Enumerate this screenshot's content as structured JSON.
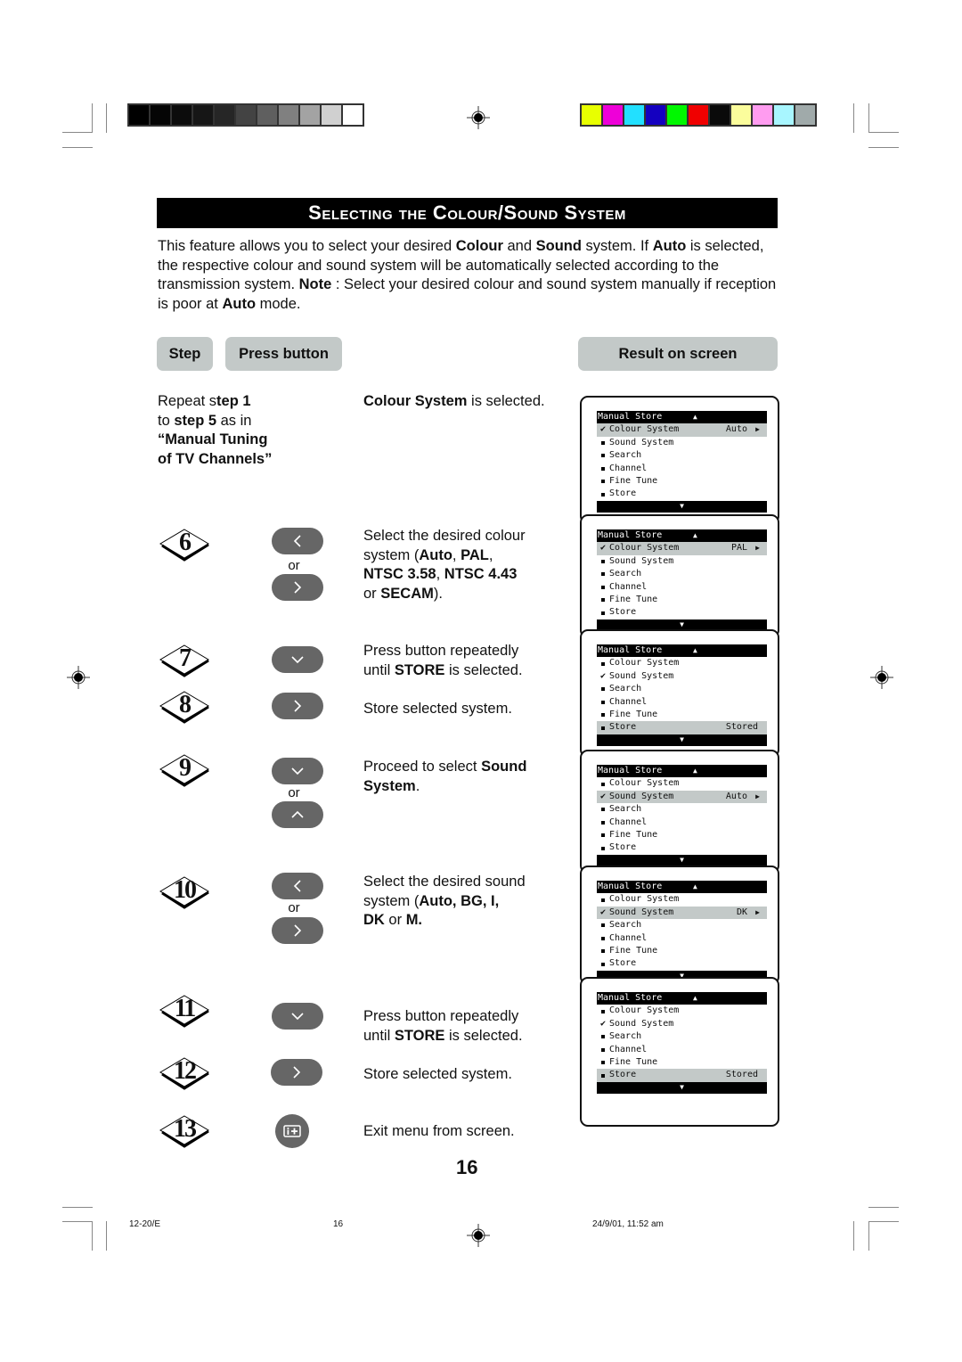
{
  "print_marks": {
    "grayscale_swatches": [
      "#000000",
      "#050505",
      "#0c0c0c",
      "#161616",
      "#262626",
      "#434343",
      "#5f5f5f",
      "#808080",
      "#a3a3a3",
      "#d0d0d0",
      "#ffffff"
    ],
    "color_swatches": [
      "#e8ff00",
      "#ee00d8",
      "#22e0ff",
      "#1400c0",
      "#00f800",
      "#f00000",
      "#0a0a0a",
      "#fbfd9c",
      "#ff9cf0",
      "#a8f6ff",
      "#a0aaaa"
    ]
  },
  "title": "Selecting the  Colour/Sound System",
  "intro": {
    "p1": "This feature allows you to select your desired ",
    "b1": "Colour",
    "p2": " and ",
    "b2": "Sound",
    "p3": " system. If ",
    "b3": "Auto",
    "p4": " is selected, the respective colour and sound system will be automatically selected according to the transmission system. ",
    "b4": "Note",
    "p5": " : Select your desired colour and sound system manually if reception is poor at ",
    "b5": "Auto",
    "p6": " mode."
  },
  "headers": {
    "step": "Step",
    "press_button": "Press button",
    "result": "Result on screen"
  },
  "pre": {
    "line1a": "Repeat s",
    "line1b": "tep 1",
    "line2a": "to ",
    "line2b": "step 5",
    "line2c": " as in",
    "line3": "“Manual Tuning",
    "line4": "of TV Channels”",
    "result_b": "Colour System",
    "result_t": " is selected."
  },
  "steps": [
    {
      "num": "6",
      "buttons": [
        "left",
        "right"
      ],
      "or": "or",
      "t1": "Select the desired colour",
      "t2a": "system  (",
      "t2b": "Auto",
      "t2c": ", ",
      "t2d": "PAL",
      "t2e": ",",
      "t3": "NTSC 3.58",
      "t3b": ", ",
      "t3c": "NTSC 4.43",
      "t4a": "or ",
      "t4b": "SECAM",
      "t4c": ")."
    },
    {
      "num": "7",
      "buttons": [
        "down"
      ],
      "t1": "Press button repeatedly",
      "t2a": "until ",
      "t2b": "STORE",
      "t2c": " is selected."
    },
    {
      "num": "8",
      "buttons": [
        "right"
      ],
      "t1": "Store selected system."
    },
    {
      "num": "9",
      "buttons": [
        "down",
        "up"
      ],
      "or": "or",
      "t1a": "Proceed to select ",
      "t1b": "Sound",
      "t2b": "System",
      "t2c": "."
    },
    {
      "num": "10",
      "buttons": [
        "left",
        "right"
      ],
      "or": "or",
      "t1": "Select the desired sound",
      "t2a": "system  (",
      "t2b": "Auto, BG, I,",
      "t3a": "DK",
      "t3b": " or ",
      "t3c": "M."
    },
    {
      "num": "11",
      "buttons": [
        "down"
      ],
      "t1": "Press button repeatedly",
      "t2a": "until ",
      "t2b": "STORE",
      "t2c": " is selected."
    },
    {
      "num": "12",
      "buttons": [
        "right"
      ],
      "t1": "Store selected system."
    },
    {
      "num": "13",
      "buttons": [
        "info"
      ],
      "t1": "Exit menu from screen."
    }
  ],
  "osd": {
    "header": "Manual Store",
    "items": [
      "Colour System",
      "Sound System",
      "Search",
      "Channel",
      "Fine Tune",
      "Store"
    ],
    "screens": [
      {
        "checked": 0,
        "highlight": 0,
        "value": "Auto"
      },
      {
        "checked": 0,
        "highlight": 0,
        "value": "PAL"
      },
      {
        "checked": 1,
        "highlight": 5,
        "value": "Stored"
      },
      {
        "checked": 1,
        "highlight": 1,
        "value": "Auto"
      },
      {
        "checked": 1,
        "highlight": 1,
        "value": "DK"
      },
      {
        "checked": 1,
        "highlight": 5,
        "value": "Stored"
      }
    ]
  },
  "page_number": "16",
  "footer": {
    "code": "12-20/E",
    "page": "16",
    "datetime": "24/9/01, 11:52 am"
  }
}
